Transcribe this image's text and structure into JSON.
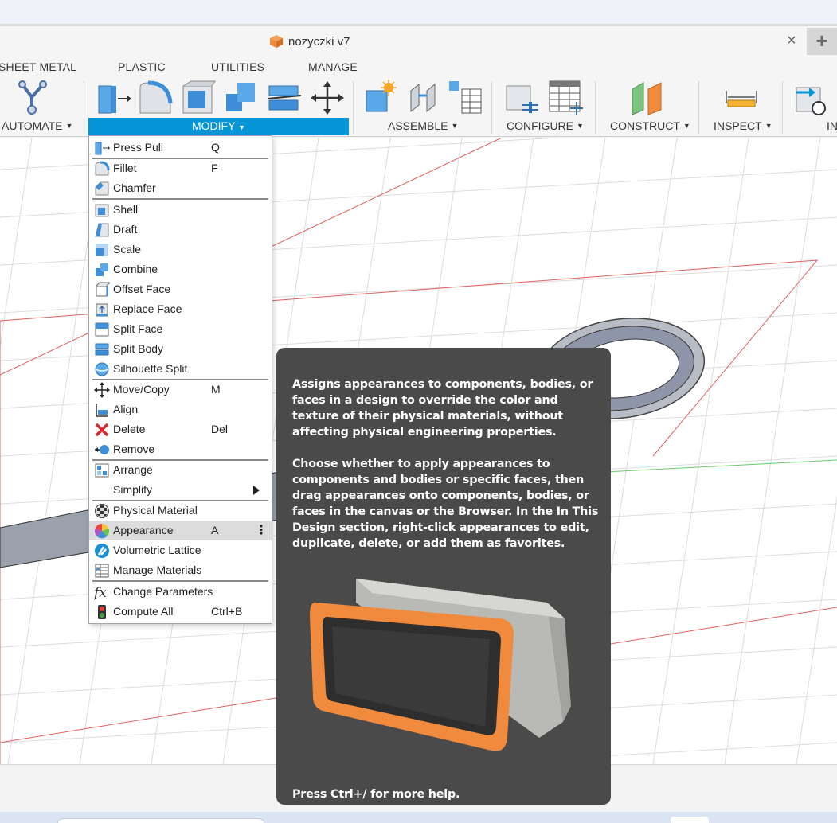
{
  "window": {
    "document_title": "nozyczki v7",
    "close_tab": "×",
    "new_tab": "+"
  },
  "workspace_tabs": [
    "SHEET METAL",
    "PLASTIC",
    "UTILITIES",
    "MANAGE"
  ],
  "toolbar_groups": {
    "automate": "AUTOMATE",
    "modify": "MODIFY",
    "assemble": "ASSEMBLE",
    "configure": "CONFIGURE",
    "construct": "CONSTRUCT",
    "inspect": "INSPECT",
    "insert_partial": "IN"
  },
  "modify_menu": {
    "items": [
      {
        "label": "Press Pull",
        "shortcut": "Q",
        "icon": "press-pull-icon"
      },
      {
        "label": "Fillet",
        "shortcut": "F",
        "icon": "fillet-icon"
      },
      {
        "label": "Chamfer",
        "shortcut": "",
        "icon": "chamfer-icon"
      },
      {
        "label": "Shell",
        "shortcut": "",
        "icon": "shell-icon"
      },
      {
        "label": "Draft",
        "shortcut": "",
        "icon": "draft-icon"
      },
      {
        "label": "Scale",
        "shortcut": "",
        "icon": "scale-icon"
      },
      {
        "label": "Combine",
        "shortcut": "",
        "icon": "combine-icon"
      },
      {
        "label": "Offset Face",
        "shortcut": "",
        "icon": "offset-face-icon"
      },
      {
        "label": "Replace Face",
        "shortcut": "",
        "icon": "replace-face-icon"
      },
      {
        "label": "Split Face",
        "shortcut": "",
        "icon": "split-face-icon"
      },
      {
        "label": "Split Body",
        "shortcut": "",
        "icon": "split-body-icon"
      },
      {
        "label": "Silhouette Split",
        "shortcut": "",
        "icon": "silhouette-split-icon"
      },
      {
        "label": "Move/Copy",
        "shortcut": "M",
        "icon": "move-copy-icon"
      },
      {
        "label": "Align",
        "shortcut": "",
        "icon": "align-icon"
      },
      {
        "label": "Delete",
        "shortcut": "Del",
        "icon": "delete-icon"
      },
      {
        "label": "Remove",
        "shortcut": "",
        "icon": "remove-icon"
      },
      {
        "label": "Arrange",
        "shortcut": "",
        "icon": "arrange-icon"
      },
      {
        "label": "Simplify",
        "shortcut": "",
        "icon": "simplify-icon"
      },
      {
        "label": "Physical Material",
        "shortcut": "",
        "icon": "physical-material-icon"
      },
      {
        "label": "Appearance",
        "shortcut": "A",
        "icon": "appearance-icon"
      },
      {
        "label": "Volumetric Lattice",
        "shortcut": "",
        "icon": "volumetric-lattice-icon"
      },
      {
        "label": "Manage Materials",
        "shortcut": "",
        "icon": "manage-materials-icon"
      },
      {
        "label": "Change Parameters",
        "shortcut": "",
        "icon": "change-parameters-icon"
      },
      {
        "label": "Compute All",
        "shortcut": "Ctrl+B",
        "icon": "compute-all-icon"
      }
    ],
    "more_glyph": "⋮"
  },
  "tooltip": {
    "paragraph1": "Assigns appearances to components, bodies, or faces in a design to override the color and texture of their physical materials, without affecting physical engineering properties.",
    "paragraph2": "Choose whether to apply appearances to components and bodies or specific faces, then drag appearances onto components, bodies, or faces in the canvas or the Browser. In the In This Design section, right-click appearances to edit, duplicate, delete, or add them as favorites.",
    "footer": "Press Ctrl+/ for more help."
  },
  "colors": {
    "accent_blue": "#0696d7",
    "tooltip_bg": "#4a4a4a",
    "sketch_red": "#e06060",
    "orange": "#f08a3c"
  }
}
